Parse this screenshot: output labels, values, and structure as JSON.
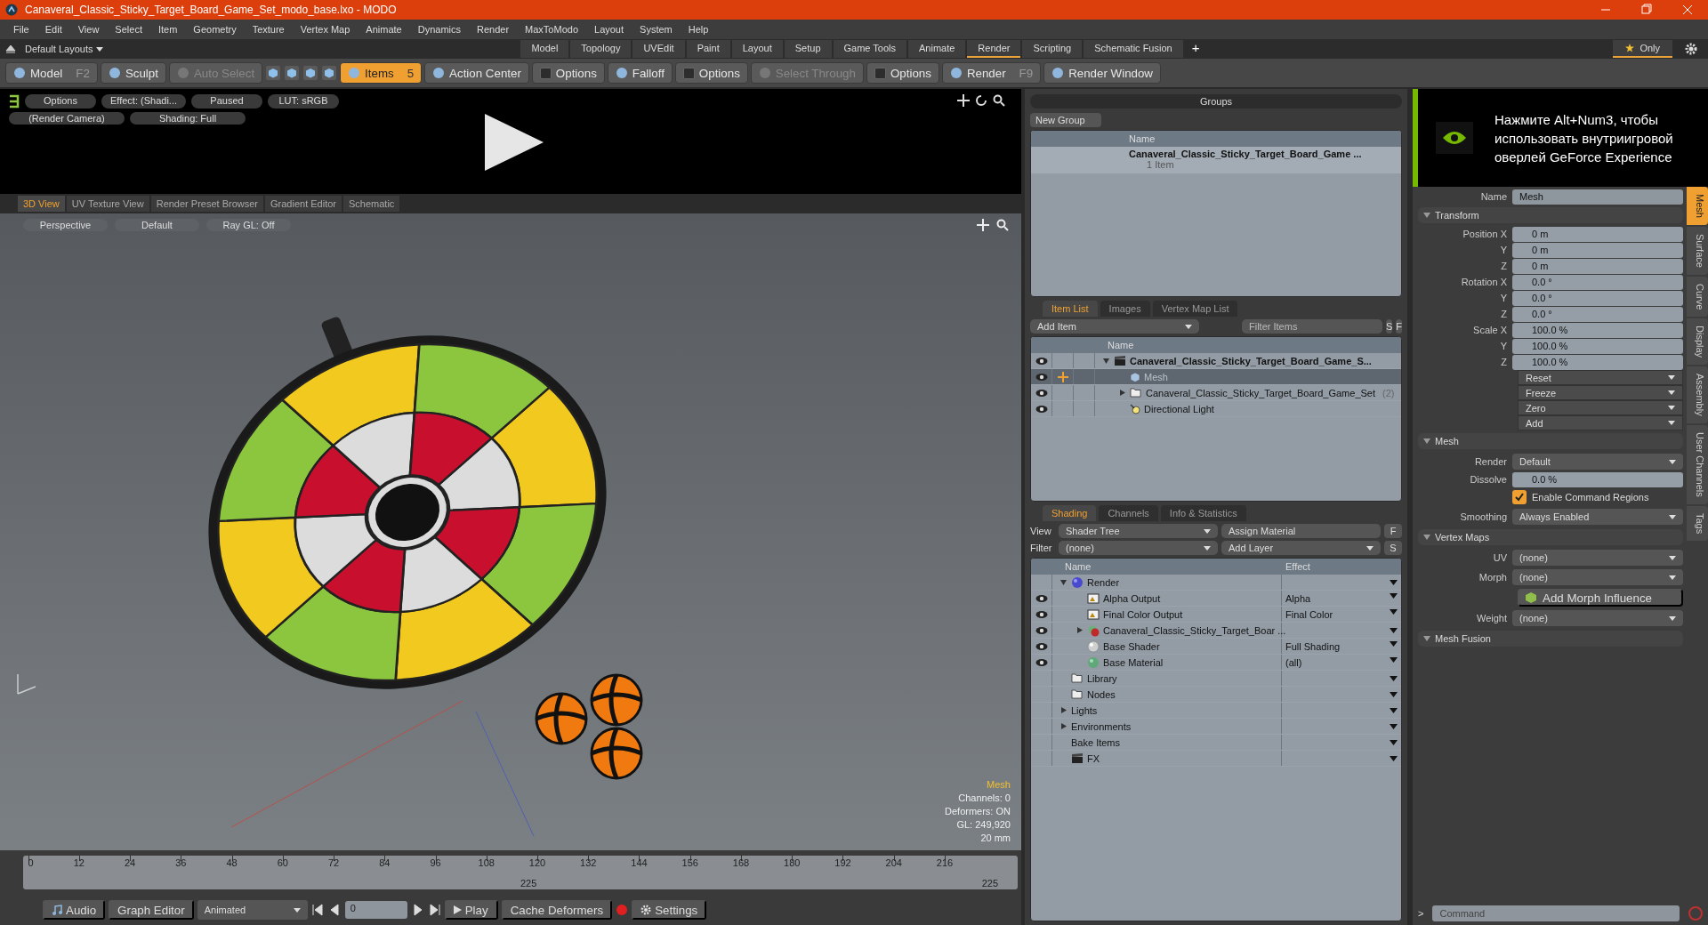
{
  "window": {
    "title": "Canaveral_Classic_Sticky_Target_Board_Game_Set_modo_base.lxo - MODO"
  },
  "menu": [
    "File",
    "Edit",
    "View",
    "Select",
    "Item",
    "Geometry",
    "Texture",
    "Vertex Map",
    "Animate",
    "Dynamics",
    "Render",
    "MaxToModo",
    "Layout",
    "System",
    "Help"
  ],
  "layout_bar": {
    "layouts": "Default Layouts",
    "tabs": [
      {
        "label": "Model",
        "selected": false
      },
      {
        "label": "Topology",
        "selected": false
      },
      {
        "label": "UVEdit",
        "selected": false
      },
      {
        "label": "Paint",
        "selected": false
      },
      {
        "label": "Layout",
        "selected": false
      },
      {
        "label": "Setup",
        "selected": false
      },
      {
        "label": "Game Tools",
        "selected": false
      },
      {
        "label": "Animate",
        "selected": false
      },
      {
        "label": "Render",
        "selected": true
      },
      {
        "label": "Scripting",
        "selected": false
      },
      {
        "label": "Schematic Fusion",
        "selected": false
      }
    ],
    "add": "+",
    "only": "Only"
  },
  "toolbar": [
    {
      "kind": "tool",
      "label": "Model",
      "shortcut": "F2",
      "selected": false,
      "disabled": false
    },
    {
      "kind": "tool",
      "label": "Sculpt",
      "selected": false,
      "disabled": false
    },
    {
      "kind": "tool",
      "label": "Auto Select",
      "selected": false,
      "disabled": true
    },
    {
      "kind": "icon",
      "selected": false,
      "disabled": false
    },
    {
      "kind": "icon",
      "selected": false,
      "disabled": false
    },
    {
      "kind": "icon",
      "selected": false,
      "disabled": false
    },
    {
      "kind": "icon",
      "selected": false,
      "disabled": false
    },
    {
      "kind": "tool",
      "label": "Items",
      "shortcut": "5",
      "selected": true,
      "disabled": false
    },
    {
      "kind": "tool",
      "label": "Action Center",
      "selected": false,
      "disabled": false
    },
    {
      "kind": "option",
      "label": "Options",
      "selected": false,
      "disabled": false
    },
    {
      "kind": "tool",
      "label": "Falloff",
      "selected": false,
      "disabled": false
    },
    {
      "kind": "option",
      "label": "Options",
      "selected": false,
      "disabled": false
    },
    {
      "kind": "tool",
      "label": "Select Through",
      "selected": false,
      "disabled": true
    },
    {
      "kind": "option",
      "label": "Options",
      "selected": false,
      "disabled": false
    },
    {
      "kind": "tool",
      "label": "Render",
      "shortcut": "F9",
      "selected": false,
      "disabled": false
    },
    {
      "kind": "tool",
      "label": "Render Window",
      "selected": false,
      "disabled": false
    }
  ],
  "preview": {
    "pills": [
      "Options",
      "Effect: (Shadi...",
      "Paused",
      "LUT: sRGB"
    ],
    "pills_row2": [
      "(Render Camera)",
      "Shading: Full"
    ]
  },
  "view_tabs": [
    {
      "label": "3D View",
      "selected": true
    },
    {
      "label": "UV Texture View",
      "selected": false
    },
    {
      "label": "Render Preset Browser",
      "selected": false
    },
    {
      "label": "Gradient Editor",
      "selected": false
    },
    {
      "label": "Schematic",
      "selected": false
    }
  ],
  "viewport": {
    "pills": [
      "Perspective",
      "Default",
      "Ray GL: Off"
    ],
    "info": [
      "Mesh",
      "Channels: 0",
      "Deformers: ON",
      "GL: 249,920",
      "20 mm"
    ]
  },
  "timeline": {
    "ticks": [
      "0",
      "12",
      "24",
      "36",
      "48",
      "60",
      "72",
      "84",
      "96",
      "108",
      "120",
      "132",
      "144",
      "156",
      "168",
      "180",
      "192",
      "204",
      "216"
    ],
    "middle": "225",
    "end": "225"
  },
  "bottom_bar": {
    "audio": "Audio",
    "graph_editor": "Graph Editor",
    "mode": "Animated",
    "frame": "0",
    "play": "Play",
    "cache": "Cache Deformers",
    "settings": "Settings"
  },
  "groups": {
    "title": "Groups",
    "new_group": "New Group",
    "column": "Name",
    "rows": [
      {
        "name": "Canaveral_Classic_Sticky_Target_Board_Game ...",
        "count": "1 Item"
      }
    ]
  },
  "item_list": {
    "tabs": [
      {
        "label": "Item List",
        "selected": true
      },
      {
        "label": "Images",
        "selected": false
      },
      {
        "label": "Vertex Map List",
        "selected": false
      }
    ],
    "add_item": "Add Item",
    "filter": {
      "placeholder": "Filter Items"
    },
    "s": "S",
    "f": "F",
    "column": "Name",
    "tree": [
      {
        "name": "Canaveral_Classic_Sticky_Target_Board_Game_S...",
        "kind": "scene",
        "visible": true,
        "selected": false,
        "expandable": true,
        "expanded": true,
        "children": [
          {
            "name": "Mesh",
            "kind": "mesh",
            "visible": true,
            "selected": true,
            "expandable": false
          },
          {
            "name": "Canaveral_Classic_Sticky_Target_Board_Game_Set",
            "count": "(2)",
            "kind": "group",
            "visible": true,
            "selected": false,
            "expandable": true,
            "expanded": false
          },
          {
            "name": "Directional Light",
            "kind": "light",
            "visible": true,
            "selected": false,
            "expandable": false
          }
        ]
      }
    ]
  },
  "shading": {
    "tabs": [
      {
        "label": "Shading",
        "selected": true
      },
      {
        "label": "Channels",
        "selected": false
      },
      {
        "label": "Info & Statistics",
        "selected": false
      }
    ],
    "view_label": "View",
    "view": "Shader Tree",
    "assign": "Assign Material",
    "f": "F",
    "filter_label": "Filter",
    "filter": "(none)",
    "add_layer": "Add Layer",
    "s": "S",
    "columns": [
      "Name",
      "Effect"
    ],
    "tree": [
      {
        "name": "Render",
        "kind": "render",
        "visible": false,
        "selected": false,
        "expandable": true,
        "expanded": true,
        "children": [
          {
            "name": "Alpha Output",
            "effect": "Alpha",
            "kind": "output",
            "visible": true,
            "selected": false,
            "expandable": false
          },
          {
            "name": "Final Color Output",
            "effect": "Final Color",
            "kind": "output",
            "visible": true,
            "selected": false,
            "expandable": false
          },
          {
            "name": "Canaveral_Classic_Sticky_Target_Boar ...",
            "kind": "material_group",
            "visible": true,
            "selected": false,
            "expandable": true,
            "expanded": false
          },
          {
            "name": "Base Shader",
            "effect": "Full Shading",
            "kind": "shader",
            "visible": true,
            "selected": false,
            "expandable": false
          },
          {
            "name": "Base Material",
            "effect": "(all)",
            "kind": "material",
            "visible": true,
            "selected": false,
            "expandable": false
          }
        ]
      },
      {
        "name": "Library",
        "kind": "folder",
        "visible": false,
        "selected": false,
        "expandable": false
      },
      {
        "name": "Nodes",
        "kind": "folder",
        "visible": false,
        "selected": false,
        "expandable": false
      },
      {
        "name": "Lights",
        "kind": "plain",
        "visible": false,
        "selected": false,
        "expandable": true,
        "expanded": false
      },
      {
        "name": "Environments",
        "kind": "plain",
        "visible": false,
        "selected": false,
        "expandable": true,
        "expanded": false
      },
      {
        "name": "Bake Items",
        "kind": "plain",
        "visible": false,
        "selected": false,
        "expandable": false
      },
      {
        "name": "FX",
        "kind": "scene",
        "visible": false,
        "selected": false,
        "expandable": false
      }
    ]
  },
  "overlay": {
    "text": "Нажмите Alt+Num3, чтобы использовать внутриигровой оверлей GeForce Experience"
  },
  "properties": {
    "name_label": "Name",
    "name_value": "Mesh",
    "sections": [
      {
        "title": "Transform",
        "expanded": true,
        "rows": [
          {
            "kind": "field",
            "label": "Position X",
            "value": "0 m"
          },
          {
            "kind": "field",
            "label": "Y",
            "value": "0 m"
          },
          {
            "kind": "field",
            "label": "Z",
            "value": "0 m"
          },
          {
            "kind": "field",
            "label": "Rotation X",
            "value": "0.0 °"
          },
          {
            "kind": "field",
            "label": "Y",
            "value": "0.0 °"
          },
          {
            "kind": "field",
            "label": "Z",
            "value": "0.0 °"
          },
          {
            "kind": "field",
            "label": "Scale X",
            "value": "100.0 %"
          },
          {
            "kind": "field",
            "label": "Y",
            "value": "100.0 %"
          },
          {
            "kind": "field",
            "label": "Z",
            "value": "100.0 %"
          },
          {
            "kind": "menu",
            "value": "Reset"
          },
          {
            "kind": "menu",
            "value": "Freeze"
          },
          {
            "kind": "menu",
            "value": "Zero"
          },
          {
            "kind": "menu",
            "value": "Add"
          }
        ]
      },
      {
        "title": "Mesh",
        "expanded": true,
        "rows": [
          {
            "kind": "dropdown",
            "label": "Render",
            "value": "Default"
          },
          {
            "kind": "field",
            "label": "Dissolve",
            "value": "0.0 %"
          },
          {
            "kind": "checkbox",
            "label": "Enable Command Regions",
            "checked": true
          },
          {
            "kind": "dropdown",
            "label": "Smoothing",
            "value": "Always Enabled"
          }
        ]
      },
      {
        "title": "Vertex Maps",
        "expanded": true,
        "rows": [
          {
            "kind": "dropdown",
            "label": "UV",
            "value": "(none)"
          },
          {
            "kind": "dropdown",
            "label": "Morph",
            "value": "(none)"
          },
          {
            "kind": "button",
            "value": "Add Morph Influence"
          },
          {
            "kind": "dropdown",
            "label": "Weight",
            "value": "(none)"
          }
        ]
      },
      {
        "title": "Mesh Fusion",
        "expanded": true
      }
    ],
    "side_tabs": [
      {
        "label": "Mesh",
        "selected": true
      },
      {
        "label": "Surface",
        "selected": false
      },
      {
        "label": "Curve",
        "selected": false
      },
      {
        "label": "Display",
        "selected": false
      },
      {
        "label": "Assembly",
        "selected": false
      },
      {
        "label": "User Channels",
        "selected": false
      },
      {
        "label": "Tags",
        "selected": false
      }
    ]
  },
  "command": {
    "prompt": ">",
    "placeholder": "Command"
  }
}
